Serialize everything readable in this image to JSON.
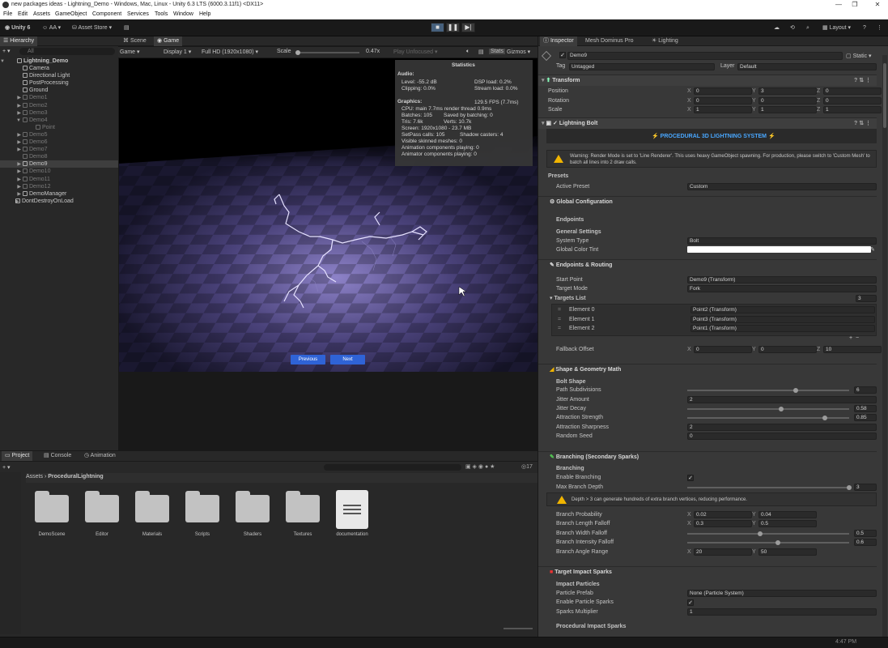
{
  "window": {
    "title": "new packages ideas - Lightning_Demo - Windows, Mac, Linux - Unity 6.3 LTS (6000.3.11f1) <DX11>"
  },
  "menu": [
    "File",
    "Edit",
    "Assets",
    "GameObject",
    "Component",
    "Services",
    "Tools",
    "Window",
    "Help"
  ],
  "toolbar": {
    "unity": "Unity 6",
    "account": "AA",
    "store": "Asset Store",
    "layout": "Layout"
  },
  "hierarchy": {
    "tab": "Hierarchy",
    "search": "All",
    "scene": "Lightning_Demo",
    "items": [
      "Camera",
      "Directional Light",
      "PostProcessing",
      "Ground",
      "Demo1",
      "Demo2",
      "Demo3",
      "Demo4",
      "Point",
      "Demo5",
      "Demo6",
      "Demo7",
      "Demo8",
      "Demo9",
      "Demo10",
      "Demo11",
      "Demo12",
      "DemoManager"
    ],
    "dontdestroy": "DontDestroyOnLoad"
  },
  "game": {
    "tabs": [
      "Scene",
      "Game"
    ],
    "display_mode": "Game",
    "display": "Display 1",
    "resolution": "Full HD (1920x1080)",
    "scale_label": "Scale",
    "scale_value": "0.47x",
    "play_mode": "Play Unfocused",
    "stats_btn": "Stats",
    "gizmos": "Gizmos",
    "prev": "Previous",
    "next": "Next"
  },
  "stats": {
    "title": "Statistics",
    "audio": "Audio:",
    "level": "Level: -55.2 dB",
    "clipping": "Clipping: 0.0%",
    "dsp": "DSP load: 0.2%",
    "stream": "Stream load: 0.0%",
    "graphics": "Graphics:",
    "fps": "129.5 FPS (7.7ms)",
    "cpu": "CPU: main 7.7ms  render thread 0.9ms",
    "batches": "Batches: 105",
    "saved": "Saved by batching: 0",
    "tris": "Tris: 7.6k",
    "verts": "Verts: 10.7k",
    "screen": "Screen: 1920x1080 - 23.7 MB",
    "setpass": "SetPass calls: 105",
    "shadow": "Shadow casters: 4",
    "skinned": "Visible skinned meshes: 0",
    "anim": "Animation components playing: 0",
    "animator": "Animator components playing: 0"
  },
  "project": {
    "tabs": [
      "Project",
      "Console",
      "Animation"
    ],
    "path1": "Assets",
    "path2": "ProceduralLightning",
    "count": "17",
    "folders": [
      "DemoScene",
      "Editor",
      "Materials",
      "Scripts",
      "Shaders",
      "Textures"
    ],
    "doc": "documentation"
  },
  "inspector": {
    "tabs": [
      "Inspector",
      "Mesh Dominus Pro",
      "Lighting"
    ],
    "object": "Demo9",
    "static": "Static",
    "tag_label": "Tag",
    "tag": "Untagged",
    "layer_label": "Layer",
    "layer": "Default",
    "transform": "Transform",
    "position": "Position",
    "rotation": "Rotation",
    "scale": "Scale",
    "pos": [
      "0",
      "3",
      "0"
    ],
    "rot": [
      "0",
      "0",
      "0"
    ],
    "scl": [
      "1",
      "1",
      "1"
    ],
    "component": "Lightning Bolt",
    "banner": "PROCEDURAL 3D LIGHTNING SYSTEM",
    "warning": "Warning: Render Mode is set to 'Line Renderer'. This uses heavy GameObject spawning. For production, please switch to 'Custom Mesh' to batch all lines into 2 draw calls.",
    "presets": "Presets",
    "active_preset": "Active Preset",
    "preset_val": "Custom",
    "global": "Global Configuration",
    "endpoints": "Endpoints",
    "general": "General Settings",
    "system_type": "System Type",
    "system_val": "Bolt",
    "tint": "Global Color Tint",
    "routing": "Endpoints & Routing",
    "start": "Start Point",
    "start_val": "Demo9 (Transform)",
    "target_mode": "Target Mode",
    "target_val": "Fork",
    "targets": "Targets List",
    "targets_count": "3",
    "elements": [
      {
        "l": "Element 0",
        "v": "Point2 (Transform)"
      },
      {
        "l": "Element 1",
        "v": "Point3 (Transform)"
      },
      {
        "l": "Element 2",
        "v": "Point1 (Transform)"
      }
    ],
    "fallback": "Fallback Offset",
    "fb": [
      "0",
      "0",
      "10"
    ],
    "shape": "Shape & Geometry Math",
    "bolt_shape": "Bolt Shape",
    "path_sub": "Path Subdivisions",
    "path_sub_v": "6",
    "jitter": "Jitter Amount",
    "jitter_v": "2",
    "jdecay": "Jitter Decay",
    "jdecay_v": "0.58",
    "astr": "Attraction Strength",
    "astr_v": "0.85",
    "asharp": "Attraction Sharpness",
    "asharp_v": "2",
    "seed": "Random Seed",
    "seed_v": "0",
    "branching_h": "Branching (Secondary Sparks)",
    "branching": "Branching",
    "enable_br": "Enable Branching",
    "max_depth": "Max Branch Depth",
    "max_depth_v": "3",
    "depth_warn": "Depth > 3 can generate hundreds of extra branch vertices, reducing performance.",
    "bprob": "Branch Probability",
    "bprob_v": [
      "0.02",
      "0.04"
    ],
    "blen": "Branch Length Falloff",
    "blen_v": [
      "0.3",
      "0.5"
    ],
    "bwid": "Branch Width Falloff",
    "bwid_v": "0.5",
    "bint": "Branch Intensity Falloff",
    "bint_v": "0.6",
    "bang": "Branch Angle Range",
    "bang_v": [
      "20",
      "50"
    ],
    "impact_h": "Target Impact Sparks",
    "impact": "Impact Particles",
    "prefab": "Particle Prefab",
    "prefab_v": "None (Particle System)",
    "enable_ps": "Enable Particle Sparks",
    "sparks_mult": "Sparks Multiplier",
    "sparks_mult_v": "1",
    "proc": "Procedural Impact Sparks"
  },
  "status": {
    "time": "4:47 PM"
  }
}
